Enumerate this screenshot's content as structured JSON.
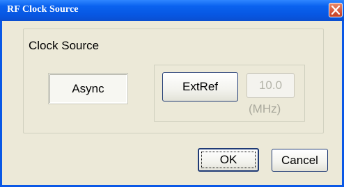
{
  "window": {
    "title": "RF Clock Source"
  },
  "group": {
    "legend": "Clock Source"
  },
  "buttons": {
    "async_label": "Async",
    "extref_label": "ExtRef",
    "value_label": "10.0",
    "unit_label": "(MHz)",
    "ok_label": "OK",
    "cancel_label": "Cancel"
  },
  "colors": {
    "titlebar": "#0a62ef",
    "window_bg": "#ece9d8",
    "close_button": "#d6553a",
    "disabled_text": "#b3b3a8"
  },
  "icons": {
    "close": "close-icon"
  }
}
